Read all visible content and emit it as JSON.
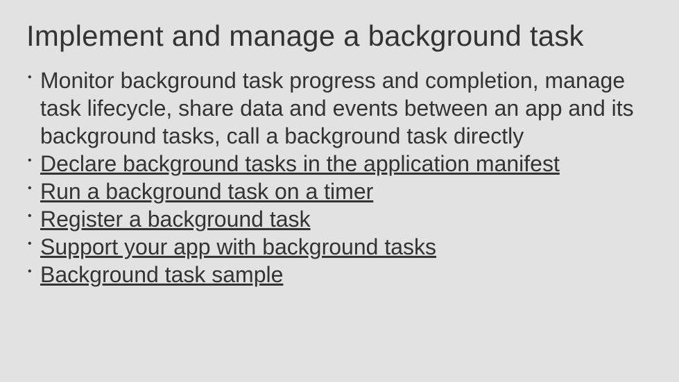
{
  "title": "Implement and manage a background task",
  "bullets": [
    {
      "text": "Monitor background task progress and completion, manage task lifecycle, share data and events between an app and its background tasks, call a background task directly",
      "link": false
    },
    {
      "text": "Declare background tasks in the application manifest",
      "link": true
    },
    {
      "text": "Run a background task on a timer",
      "link": true
    },
    {
      "text": "Register a background task",
      "link": true
    },
    {
      "text": "Support your app with background tasks",
      "link": true
    },
    {
      "text": "Background task sample",
      "link": true
    }
  ]
}
